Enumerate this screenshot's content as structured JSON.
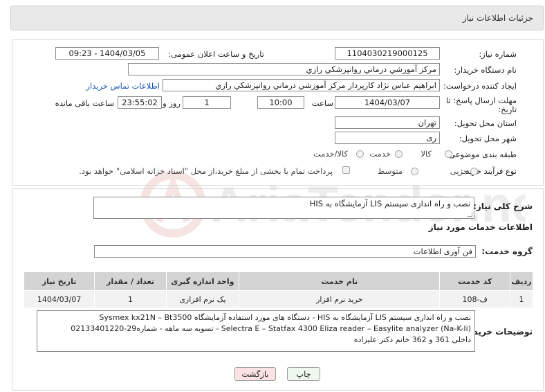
{
  "header": {
    "title": "جزئیات اطلاعات نیاز"
  },
  "form": {
    "need_number_label": "شماره نیاز:",
    "need_number": "1104030219000125",
    "announce_label": "تاریخ و ساعت اعلان عمومی:",
    "announce_value": "1404/03/05 - 09:23",
    "buyer_org_label": "نام دستگاه خریدار:",
    "buyer_org": "مرکز آموزشي درماني روانپزشکي رازي",
    "requester_label": "ایجاد کننده درخواست:",
    "requester": "ابراهیم عباس نژاد کارپرداز مرکز آموزشي درماني روانپزشکي رازي",
    "contact_link": "اطلاعات تماس خریدار",
    "deadline_label_1": "مهلت ارسال پاسخ: تا",
    "deadline_label_2": "تاریخ:",
    "deadline_date": "1404/03/07",
    "time_label": "ساعت",
    "deadline_time": "10:00",
    "days_value": "1",
    "days_label": "روز و",
    "remaining_time": "23:55:02",
    "remaining_label": "ساعت باقی مانده",
    "province_label": "استان محل تحویل:",
    "province": "تهران",
    "city_label": "شهر محل تحویل:",
    "city": "ری",
    "category_label": "طبقه بندی موضوعی:",
    "category_options": [
      "کالا",
      "خدمت",
      "کالا/خدمت"
    ],
    "process_label": "نوع فرآیند خرید :",
    "process_options": [
      "جزیی",
      "متوسط"
    ],
    "payment_note": "پرداخت تمام یا بخشی از مبلغ خرید،از محل \"اسناد خزانه اسلامی\" خواهد بود."
  },
  "summary": {
    "label": "شرح کلی نیاز:",
    "text": "نصب و راه اندازی سیستم LIS آزمایشگاه به HIS"
  },
  "services": {
    "section_title": "اطلاعات خدمات مورد نیاز",
    "group_label": "گروه خدمت:",
    "group_value": "فن آوری اطلاعات",
    "columns": [
      "ردیف",
      "کد خدمت",
      "نام خدمت",
      "واحد اندازه گیری",
      "تعداد / مقدار",
      "تاریخ نیاز"
    ],
    "rows": [
      [
        "1",
        "ف-108",
        "خرید نرم افزار",
        "یک نرم افزاری",
        "1",
        "1404/03/07"
      ]
    ]
  },
  "buyer_notes": {
    "label": "توضیحات خریدار:",
    "line1": "نصب و راه اندازی سیستم LIS آزمایشگاه به HIS - دستگاه های مورد استفاده آزمایشگاه Sysmex kx21N – Bt3500",
    "line2": "Selectra E – Statfax 4300 Eliza reader – Easylite analyzer (Na-K-Ii) - تسویه سه ماهه -  شماره29-02133401220",
    "line3": "داخلی 361 و 362 خانم دکتر علیزاده"
  },
  "buttons": {
    "print": "چاپ",
    "back": "بازگشت"
  },
  "watermark_text": "AriaTender.neT",
  "colors": {
    "link": "#1a56b8",
    "back_button": "#fbe3e3",
    "print_button": "#eef8ee"
  }
}
